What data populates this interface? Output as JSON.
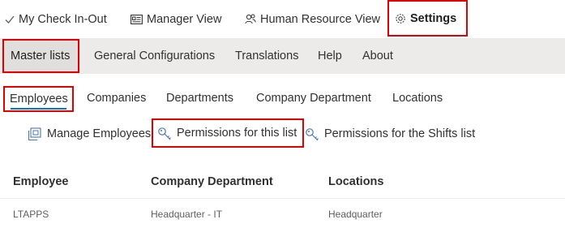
{
  "top_nav": {
    "items": [
      {
        "label": "My Check In-Out",
        "icon": "checkmark-icon"
      },
      {
        "label": "Manager View",
        "icon": "id-card-icon"
      },
      {
        "label": "Human Resource View",
        "icon": "people-icon"
      },
      {
        "label": "Settings",
        "icon": "gear-icon",
        "selected": true
      }
    ]
  },
  "sub_nav": {
    "items": [
      {
        "label": "Master lists",
        "selected": true
      },
      {
        "label": "General Configurations"
      },
      {
        "label": "Translations"
      },
      {
        "label": "Help"
      },
      {
        "label": "About"
      }
    ]
  },
  "tabs": {
    "items": [
      {
        "label": "Employees",
        "selected": true
      },
      {
        "label": "Companies"
      },
      {
        "label": "Departments"
      },
      {
        "label": "Company Department"
      },
      {
        "label": "Locations"
      }
    ]
  },
  "command_bar": {
    "items": [
      {
        "label": "Manage Employees",
        "icon": "manage-list-icon"
      },
      {
        "label": "Permissions for this list",
        "icon": "key-icon"
      },
      {
        "label": "Permissions for the Shifts list",
        "icon": "key-icon"
      }
    ]
  },
  "table": {
    "columns": [
      "Employee",
      "Company Department",
      "Locations"
    ],
    "rows": [
      [
        "LTAPPS",
        "Headquarter - IT",
        "Headquarter"
      ]
    ]
  },
  "colors": {
    "highlight_box": "#e00000",
    "accent": "#0078d4",
    "subnav_bg": "#edebe9",
    "text": "#323130"
  }
}
